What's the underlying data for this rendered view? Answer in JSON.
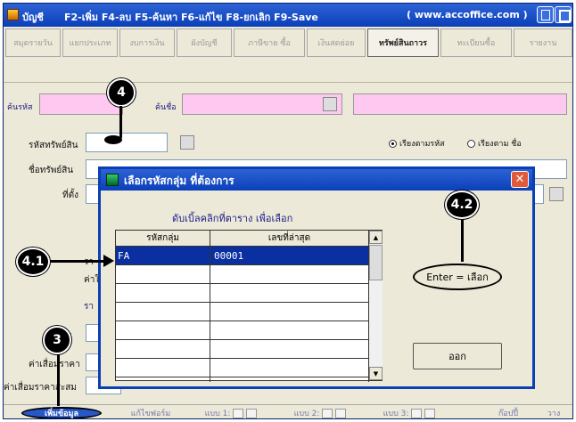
{
  "titlebar": {
    "name": "บัญชี",
    "keys": "F2-เพิ่ม F4-ลบ F5-ค้นหา F6-แก้ไข F8-ยกเลิก F9-Save",
    "website": "( www.accoffice.com )"
  },
  "tabs": [
    {
      "label": "สมุดรายวัน"
    },
    {
      "label": "แยกประเภท"
    },
    {
      "label": "งบการเงิน"
    },
    {
      "label": "ผังบัญชี"
    },
    {
      "label": "ภาษีขาย ซื้อ"
    },
    {
      "label": "เงินสดย่อย"
    },
    {
      "label": "ทรัพย์สินถาวร"
    },
    {
      "label": "ทะเบียนซื้อ"
    },
    {
      "label": "รายงาน"
    }
  ],
  "search": {
    "code_label": "ค้นรหัส",
    "name_label": "ค้นชื่อ"
  },
  "form": {
    "asset_code_label": "รหัสทรัพย์สิน",
    "asset_name_label": "ชื่อทรัพย์สิน",
    "location_label": "ที่ตั้ง",
    "sort_by_code": "เรียงตามรหัส",
    "sort_by_name": "เรียงตาม ชื่อ",
    "depreciation_label": "ค่าเสื่อมราคา",
    "accumulated_label": "ค่าเสื่อมราคาสะสม",
    "partial_1": "รา",
    "partial_2": "ค่าใ",
    "partial_3": "รา",
    "partial_4": "น"
  },
  "dialog": {
    "title": "เลือกรหัสกลุ่ม ที่ต้องการ",
    "hint": "ดับเบิ้ลคลิกที่ตาราง เพื่อเลือก",
    "columns": [
      "รหัสกลุ่ม",
      "เลขที่ล่าสุด"
    ],
    "rows": [
      {
        "group_code": "FA",
        "last_number": "00001"
      }
    ],
    "enter_button": "Enter = เลือก",
    "exit_button": "ออก"
  },
  "bottombar": {
    "add_button": "เพิ่มข้อมูล",
    "edit_form": "แก้ไขฟอร์ม",
    "form1": "แบบ 1:",
    "form2": "แบบ 2:",
    "form3": "แบบ 3:",
    "copy": "ก๊อปปี้",
    "paste": "วาง"
  },
  "annotations": [
    "4",
    "4.2",
    "4.1",
    "3"
  ]
}
